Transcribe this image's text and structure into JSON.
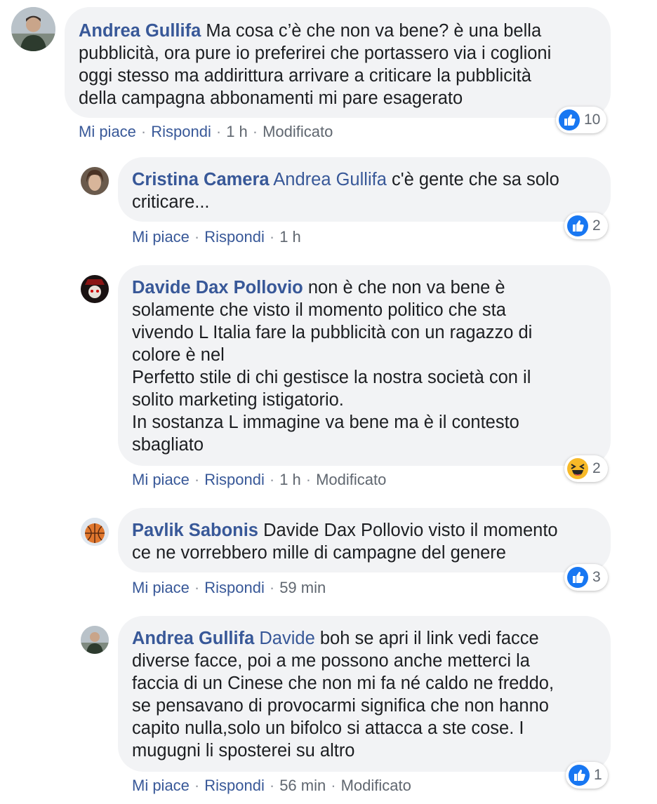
{
  "actions": {
    "like": "Mi piace",
    "reply": "Rispondi",
    "separator": "·",
    "edited": "Modificato"
  },
  "icons": {
    "like": "like-thumb-icon",
    "haha": "haha-laugh-icon"
  },
  "colors": {
    "name": "#385898",
    "bubble": "#f2f3f5",
    "meta": "#606770",
    "like_blue": "#1877f2",
    "haha_yellow": "#f7b928"
  },
  "comments": [
    {
      "author": "Andrea Gullifa",
      "mention": "",
      "text": "Ma cosa c’è che non va bene? è una bella\npubblicità, ora pure io preferirei che portassero via i coglioni\noggi stesso ma addirittura arrivare a criticare la pubblicità\ndella campagna abbonamenti mi pare esagerato",
      "time": "1 h",
      "reaction_count": "10"
    },
    {
      "author": "Cristina Camera",
      "mention": "Andrea Gullifa",
      "text": "c'è gente che sa solo\ncriticare...",
      "time": "1 h",
      "reaction_count": "2"
    },
    {
      "author": "Davide Dax Pollovio",
      "mention": "",
      "text": "non è che non va bene è\nsolamente che visto il momento politico che sta\nvivendo L Italia fare la pubblicità con un ragazzo di\ncolore è nel\nPerfetto stile di chi gestisce la nostra società con il\nsolito marketing istigatorio.\nIn sostanza L immagine va bene ma è il contesto\nsbagliato",
      "time": "1 h",
      "reaction_count": "2"
    },
    {
      "author": "Pavlik Sabonis",
      "mention": "",
      "text": "Davide Dax Pollovio visto il momento\nce ne vorrebbero mille di campagne del genere",
      "time": "59 min",
      "reaction_count": "3"
    },
    {
      "author": "Andrea Gullifa",
      "mention": "Davide",
      "text": "boh se apri il link vedi facce\ndiverse facce, poi a me possono anche metterci la\nfaccia di un Cinese che non mi fa né caldo ne freddo,\nse pensavano di provocarmi significa che non hanno\ncapito nulla,solo un bifolco si attacca a ste cose. I\nmugugni li sposterei su altro",
      "time": "56 min",
      "reaction_count": "1"
    }
  ]
}
